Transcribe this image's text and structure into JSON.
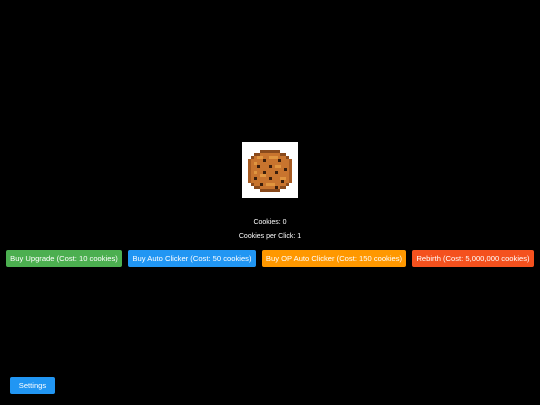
{
  "game": {
    "cookie_icon": "pixel-cookie-icon",
    "cookies_text": "Cookies: 0",
    "cookies_per_click_text": "Cookies per Click: 1"
  },
  "buttons": {
    "upgrade": {
      "label": "Buy Upgrade (Cost: 10 cookies)",
      "color": "#4caf50"
    },
    "auto_clicker": {
      "label": "Buy Auto Clicker (Cost: 50 cookies)",
      "color": "#2196f3"
    },
    "op_auto_clicker": {
      "label": "Buy OP Auto Clicker (Cost: 150 cookies)",
      "color": "#ff9800"
    },
    "rebirth": {
      "label": "Rebirth (Cost: 5,000,000 cookies)",
      "color": "#f4511e"
    },
    "settings": {
      "label": "Settings",
      "color": "#2196f3"
    }
  },
  "colors": {
    "background": "#000000",
    "text": "#ffffff",
    "cookie_base": "#c8742e",
    "cookie_light": "#e0953f",
    "cookie_dark": "#8a4a1c",
    "chocolate_chip": "#3b1e0c"
  }
}
